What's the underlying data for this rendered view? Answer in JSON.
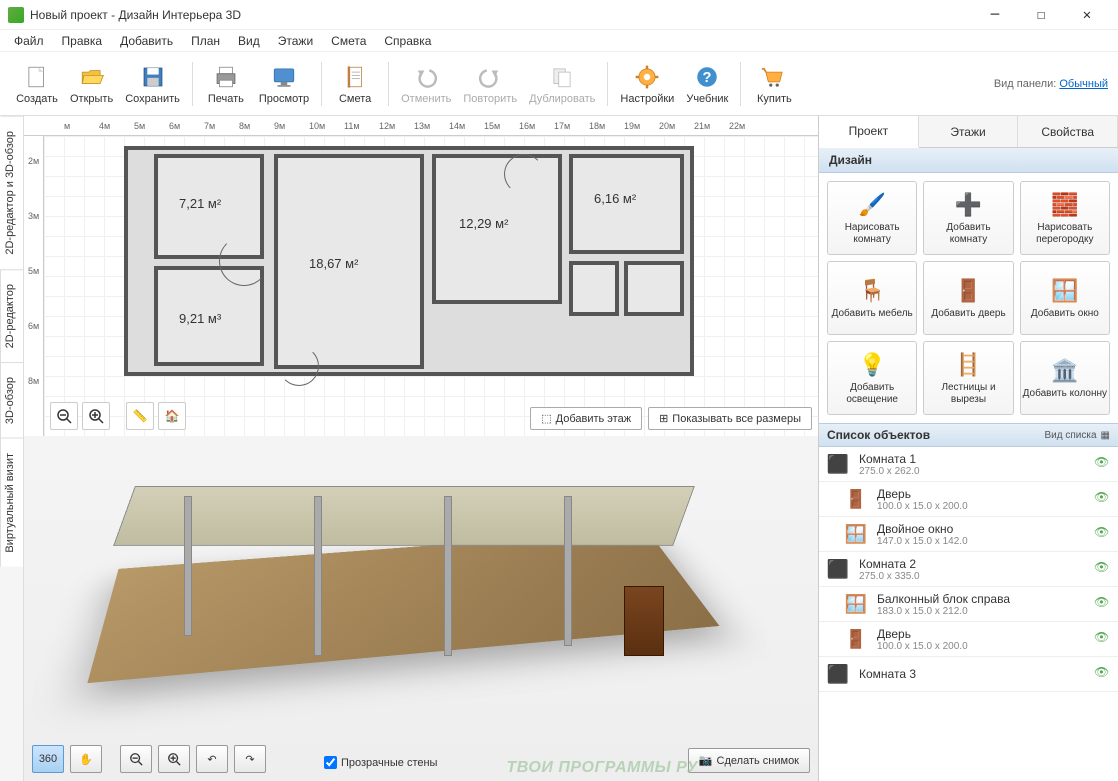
{
  "title": "Новый проект - Дизайн Интерьера 3D",
  "menu": [
    "Файл",
    "Правка",
    "Добавить",
    "План",
    "Вид",
    "Этажи",
    "Смета",
    "Справка"
  ],
  "toolbar": [
    {
      "id": "create",
      "label": "Создать"
    },
    {
      "id": "open",
      "label": "Открыть"
    },
    {
      "id": "save",
      "label": "Сохранить"
    },
    {
      "sep": true
    },
    {
      "id": "print",
      "label": "Печать"
    },
    {
      "id": "preview",
      "label": "Просмотр"
    },
    {
      "sep": true
    },
    {
      "id": "estimate",
      "label": "Смета"
    },
    {
      "sep": true
    },
    {
      "id": "undo",
      "label": "Отменить",
      "disabled": true
    },
    {
      "id": "redo",
      "label": "Повторить",
      "disabled": true
    },
    {
      "id": "duplicate",
      "label": "Дублировать",
      "disabled": true
    },
    {
      "sep": true
    },
    {
      "id": "settings",
      "label": "Настройки"
    },
    {
      "id": "help",
      "label": "Учебник"
    },
    {
      "sep": true
    },
    {
      "id": "buy",
      "label": "Купить"
    }
  ],
  "panel_mode": {
    "label": "Вид панели:",
    "value": "Обычный"
  },
  "vtabs": [
    "2D-редактор и 3D-обзор",
    "2D-редактор",
    "3D-обзор",
    "Виртуальный визит"
  ],
  "ruler_h": [
    "м",
    "4м",
    "5м",
    "6м",
    "7м",
    "8м",
    "9м",
    "10м",
    "11м",
    "12м",
    "13м",
    "14м",
    "15м",
    "16м",
    "17м",
    "18м",
    "19м",
    "20м",
    "21м",
    "22м"
  ],
  "ruler_v": [
    "2м",
    "3м",
    "5м",
    "6м",
    "8м"
  ],
  "rooms": {
    "r1": "7,21 м²",
    "r2": "18,67 м²",
    "r3": "12,29 м²",
    "r4": "6,16 м²",
    "r5": "9,21 м³"
  },
  "floor_buttons": {
    "add": "Добавить этаж",
    "dims": "Показывать все размеры"
  },
  "view3d": {
    "transparent": "Прозрачные стены",
    "snapshot": "Сделать снимок"
  },
  "sidebar_tabs": [
    "Проект",
    "Этажи",
    "Свойства"
  ],
  "design_hdr": "Дизайн",
  "design_buttons": [
    {
      "label": "Нарисовать комнату"
    },
    {
      "label": "Добавить комнату"
    },
    {
      "label": "Нарисовать перегородку"
    },
    {
      "label": "Добавить мебель"
    },
    {
      "label": "Добавить дверь"
    },
    {
      "label": "Добавить окно"
    },
    {
      "label": "Добавить освещение"
    },
    {
      "label": "Лестницы и вырезы"
    },
    {
      "label": "Добавить колонну"
    }
  ],
  "objlist_hdr": "Список объектов",
  "viewmode_label": "Вид списка",
  "objects": [
    {
      "name": "Комната 1",
      "dim": "275.0 x 262.0",
      "type": "room"
    },
    {
      "name": "Дверь",
      "dim": "100.0 x 15.0 x 200.0",
      "type": "door",
      "indent": true
    },
    {
      "name": "Двойное окно",
      "dim": "147.0 x 15.0 x 142.0",
      "type": "window",
      "indent": true
    },
    {
      "name": "Комната 2",
      "dim": "275.0 x 335.0",
      "type": "room"
    },
    {
      "name": "Балконный блок справа",
      "dim": "183.0 x 15.0 x 212.0",
      "type": "window",
      "indent": true
    },
    {
      "name": "Дверь",
      "dim": "100.0 x 15.0 x 200.0",
      "type": "door",
      "indent": true
    },
    {
      "name": "Комната 3",
      "dim": "",
      "type": "room"
    }
  ],
  "watermark": "ТВОИ ПРОГРАММЫ РУ"
}
